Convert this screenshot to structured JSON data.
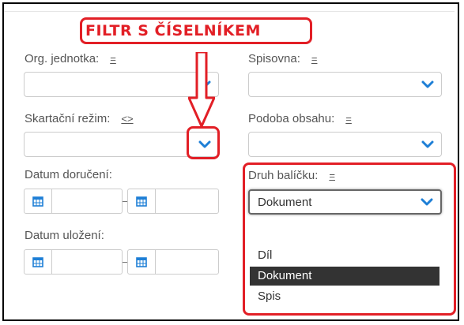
{
  "annotation": {
    "title": "FILTR S ČÍSELNÍKEM"
  },
  "fields": {
    "org_jednotka": {
      "label": "Org. jednotka:",
      "op": "=",
      "value": ""
    },
    "spisovna": {
      "label": "Spisovna:",
      "op": "=",
      "value": ""
    },
    "skartacni_rezim": {
      "label": "Skartační režim:",
      "op": "<>",
      "value": ""
    },
    "podoba_obsahu": {
      "label": "Podoba obsahu:",
      "op": "=",
      "value": ""
    },
    "datum_doruceni": {
      "label": "Datum doručení:"
    },
    "datum_ulozeni": {
      "label": "Datum uložení:"
    },
    "druh_balicku": {
      "label": "Druh balíčku:",
      "op": "=",
      "value": "Dokument"
    }
  },
  "dropdown": {
    "options": [
      "",
      "Díl",
      "Dokument",
      "Spis"
    ],
    "selected": "Dokument"
  },
  "icons": {
    "select_chevron": "chevron-down-icon",
    "date": "calendar-icon",
    "arrow": "down-arrow-icon"
  },
  "colors": {
    "accent": "#1e7fd6",
    "annotation": "#e21f26",
    "selected_bg": "#333333"
  }
}
